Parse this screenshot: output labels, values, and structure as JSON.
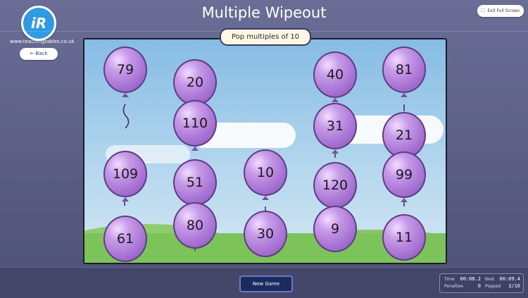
{
  "app": {
    "logo_text": "iR",
    "site_url": "www.teachingtables.co.uk",
    "back_label": "← Back",
    "title": "Multiple Wipeout",
    "exit_label": "Exit Full Screen",
    "exit_icon": "expand-icon"
  },
  "game": {
    "instruction": "Pop multiples of 10",
    "balloon_color": "#a773d4",
    "balloons": [
      "79",
      "20",
      "110",
      "109",
      "51",
      "80",
      "61",
      "10",
      "30",
      "40",
      "31",
      "120",
      "9",
      "81",
      "21",
      "99",
      "11"
    ]
  },
  "footer": {
    "new_game_label": "New Game",
    "stats": {
      "time_label": "Time",
      "time_value": "00:08.2",
      "best_label": "Best",
      "best_value": "00:09.4",
      "penalties_label": "Penalties",
      "penalties_value": "0",
      "popped_label": "Popped",
      "popped_value": "3/10"
    }
  }
}
